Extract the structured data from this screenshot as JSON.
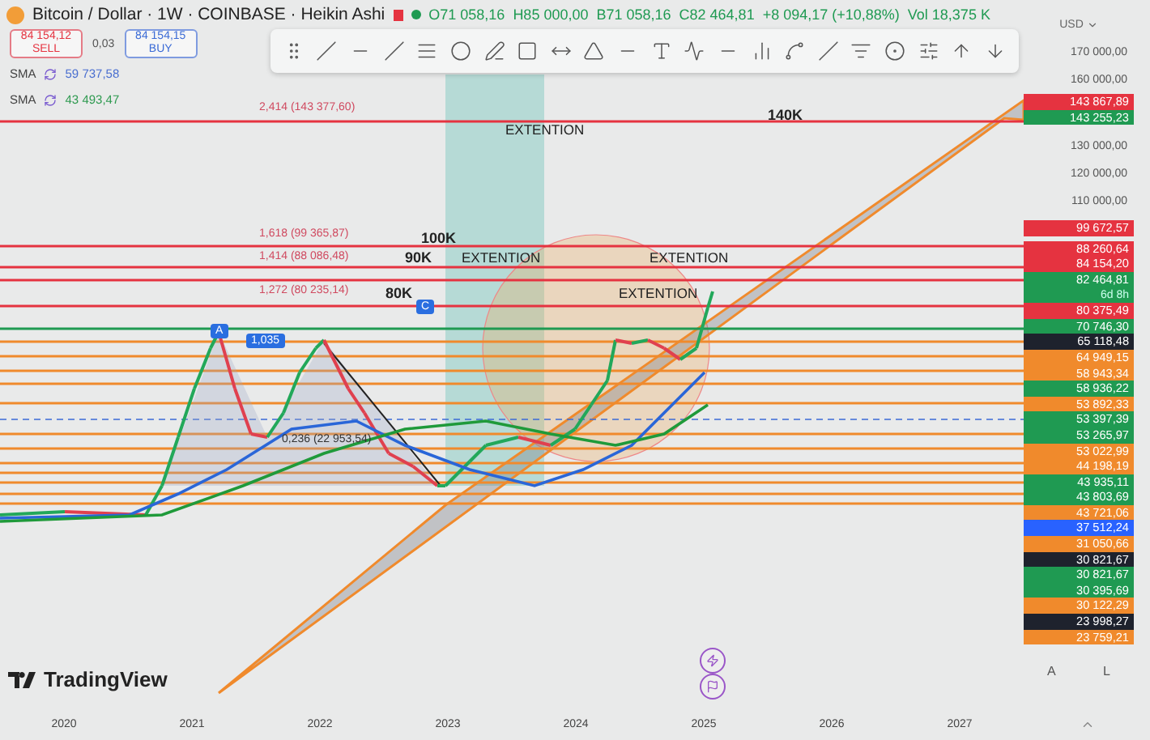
{
  "header": {
    "symbol": "Bitcoin / Dollar · 1W · COINBASE · Heikin Ashi",
    "market_open": true,
    "ohlc": [
      "O71 058,16",
      "H85 000,00",
      "B71 058,16",
      "C82 464,81"
    ],
    "change": "+8 094,17 (+10,88%)",
    "volume": "Vol 18,375 K"
  },
  "trade": {
    "sell": {
      "price": "84 154,12",
      "label": "SELL"
    },
    "spread": "0,03",
    "buy": {
      "price": "84 154,15",
      "label": "BUY"
    }
  },
  "indicators": [
    {
      "name": "SMA",
      "value": "59 737,58",
      "color": "#4a6fd0"
    },
    {
      "name": "SMA",
      "value": "43 493,47",
      "color": "#2e9a50"
    }
  ],
  "chart": {
    "fib_levels": [
      "2,414 (143 377,60)",
      "1,618 (99 365,87)",
      "1,414 (88 086,48)",
      "1,272 (80 235,14)",
      "0,236 (22 953,54)"
    ],
    "targets": [
      "140K",
      "100K",
      "90K",
      "80K"
    ],
    "extension_labels": [
      "EXTENTION",
      "EXTENTION",
      "EXTENTION",
      "EXTENTION"
    ],
    "markers": [
      "A",
      "C",
      "1,035"
    ]
  },
  "price_axis": {
    "currency": "USD",
    "upper_ticks": [
      "170 000,00",
      "160 000,00"
    ],
    "top_tags": [
      {
        "text": "143 867,89",
        "color": "#e53340"
      },
      {
        "text": "143 255,23",
        "color": "#1f9a52"
      }
    ],
    "mid_ticks": [
      "130 000,00",
      "120 000,00",
      "110 000,00"
    ],
    "lone_tag": {
      "text": "99 672,57",
      "color": "#e53340"
    },
    "tags": [
      {
        "text": "88 260,64",
        "color": "#e53340"
      },
      {
        "text": "84 154,20",
        "color": "#e53340"
      },
      {
        "text": "82 464,81",
        "sub": "6d 8h",
        "color": "#1f9a52"
      },
      {
        "text": "80 375,49",
        "color": "#e53340"
      },
      {
        "text": "70 746,30",
        "color": "#1f9a52"
      },
      {
        "text": "65 118,48",
        "color": "#1e222d"
      },
      {
        "text": "64 949,15",
        "color": "#f08a2c"
      },
      {
        "text": "58 943,34",
        "color": "#f08a2c"
      },
      {
        "text": "58 936,22",
        "color": "#1f9a52"
      },
      {
        "text": "53 892,33",
        "color": "#f08a2c"
      },
      {
        "text": "53 397,39",
        "color": "#1f9a52"
      },
      {
        "text": "53 265,97",
        "color": "#1f9a52"
      },
      {
        "text": "53 022,99",
        "color": "#f08a2c"
      },
      {
        "text": "44 198,19",
        "color": "#f08a2c"
      },
      {
        "text": "43 935,11",
        "color": "#1f9a52"
      },
      {
        "text": "43 803,69",
        "color": "#1f9a52"
      },
      {
        "text": "43 721,06",
        "color": "#f08a2c"
      },
      {
        "text": "37 512,24",
        "color": "#2962ff"
      },
      {
        "text": "31 050,66",
        "color": "#f08a2c"
      },
      {
        "text": "30 821,67",
        "color": "#1e222d"
      },
      {
        "text": "30 821,67",
        "color": "#1f9a52"
      },
      {
        "text": "30 395,69",
        "color": "#1f9a52"
      },
      {
        "text": "30 122,29",
        "color": "#f08a2c"
      },
      {
        "text": "23 998,27",
        "color": "#1e222d"
      },
      {
        "text": "23 759,21",
        "color": "#f08a2c"
      }
    ],
    "buttons": [
      "A",
      "L"
    ]
  },
  "time_axis": [
    "2020",
    "2021",
    "2022",
    "2023",
    "2024",
    "2025",
    "2026",
    "2027"
  ],
  "logo": "TradingView"
}
